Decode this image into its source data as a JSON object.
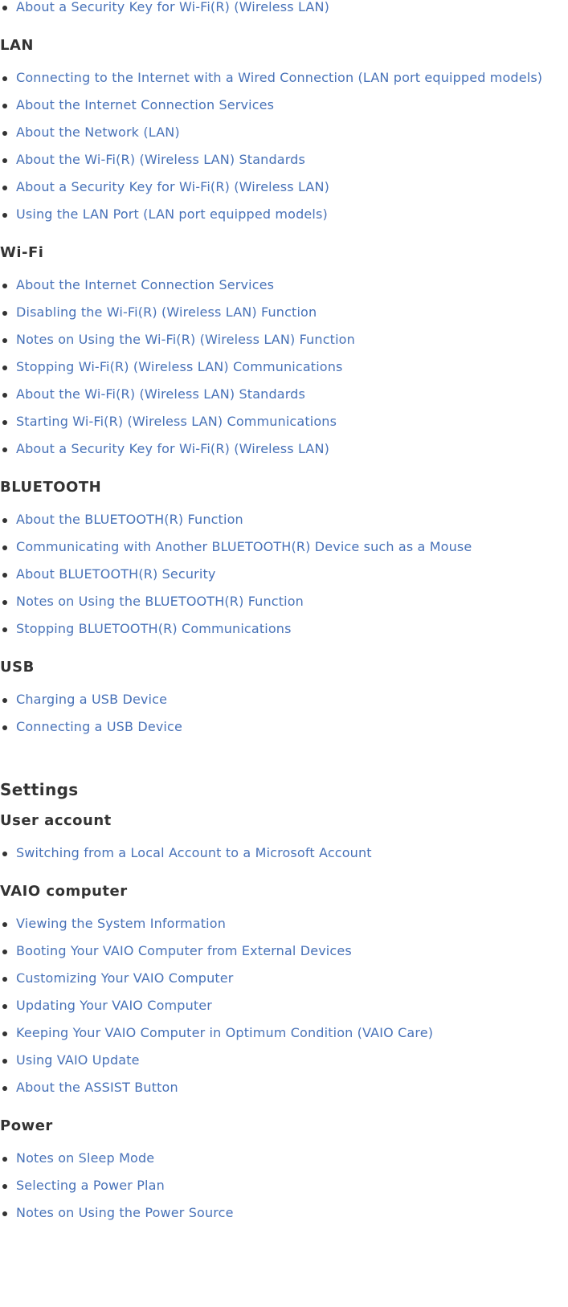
{
  "colors": {
    "link": "#4872b8",
    "heading": "#333333",
    "background": "#ffffff"
  },
  "top_item": {
    "label": "About a Security Key for Wi-Fi(R) (Wireless LAN)"
  },
  "sections": {
    "lan": {
      "title": "LAN",
      "items": [
        "Connecting to the Internet with a Wired Connection (LAN port equipped models)",
        "About the Internet Connection Services",
        "About the Network (LAN)",
        "About the Wi-Fi(R) (Wireless LAN) Standards",
        "About a Security Key for Wi-Fi(R) (Wireless LAN)",
        "Using the LAN Port (LAN port equipped models)"
      ]
    },
    "wifi": {
      "title": "Wi-Fi",
      "items": [
        "About the Internet Connection Services",
        "Disabling the Wi-Fi(R) (Wireless LAN) Function",
        "Notes on Using the Wi-Fi(R) (Wireless LAN) Function",
        "Stopping Wi-Fi(R) (Wireless LAN) Communications",
        "About the Wi-Fi(R) (Wireless LAN) Standards",
        "Starting Wi-Fi(R) (Wireless LAN) Communications",
        "About a Security Key for Wi-Fi(R) (Wireless LAN)"
      ]
    },
    "bluetooth": {
      "title": "BLUETOOTH",
      "items": [
        "About the BLUETOOTH(R) Function",
        "Communicating with Another BLUETOOTH(R) Device such as a Mouse",
        "About BLUETOOTH(R) Security",
        "Notes on Using the BLUETOOTH(R) Function",
        "Stopping BLUETOOTH(R) Communications"
      ]
    },
    "usb": {
      "title": "USB",
      "items": [
        "Charging a USB Device",
        "Connecting a USB Device"
      ]
    }
  },
  "settings": {
    "title": "Settings",
    "user_account": {
      "title": "User account",
      "items": [
        "Switching from a Local Account to a Microsoft Account"
      ]
    },
    "vaio_computer": {
      "title": "VAIO computer",
      "items": [
        "Viewing the System Information",
        "Booting Your VAIO Computer from External Devices",
        "Customizing Your VAIO Computer",
        "Updating Your VAIO Computer",
        "Keeping Your VAIO Computer in Optimum Condition (VAIO Care)",
        "Using VAIO Update",
        "About the ASSIST Button"
      ]
    },
    "power": {
      "title": "Power",
      "items": [
        "Notes on Sleep Mode",
        "Selecting a Power Plan",
        "Notes on Using the Power Source"
      ]
    }
  }
}
